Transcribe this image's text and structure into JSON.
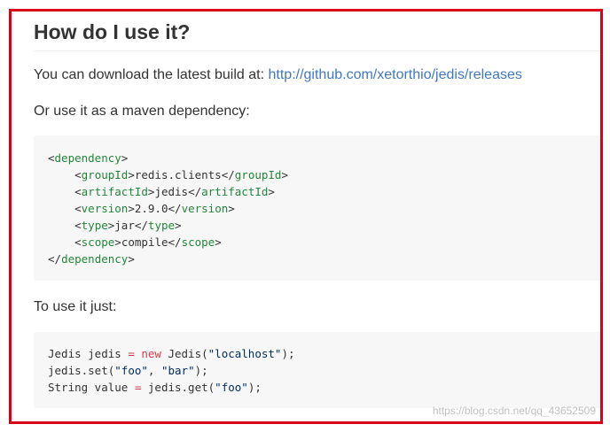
{
  "section": {
    "heading": "How do I use it?",
    "download_text": "You can download the latest build at: ",
    "download_link": "http://github.com/xetorthio/jedis/releases",
    "maven_text": "Or use it as a maven dependency:",
    "usage_text": "To use it just:"
  },
  "xml_code": {
    "dependency_tag": "dependency",
    "groupId_tag": "groupId",
    "groupId_value": "redis.clients",
    "artifactId_tag": "artifactId",
    "artifactId_value": "jedis",
    "version_tag": "version",
    "version_value": "2.9.0",
    "type_tag": "type",
    "type_value": "jar",
    "scope_tag": "scope",
    "scope_value": "compile"
  },
  "java_code": {
    "line1_a": "Jedis jedis ",
    "line1_op": "=",
    "line1_kw": "new",
    "line1_b": " Jedis(",
    "line1_str": "\"localhost\"",
    "line1_c": ");",
    "line2_a": "jedis.set(",
    "line2_str1": "\"foo\"",
    "line2_b": ", ",
    "line2_str2": "\"bar\"",
    "line2_c": ");",
    "line3_a": "String value ",
    "line3_op": "=",
    "line3_b": " jedis.get(",
    "line3_str": "\"foo\"",
    "line3_c": ");"
  },
  "watermark": "https://blog.csdn.net/qq_43652509",
  "colors": {
    "frame_border": "#d9001b",
    "link": "#4078c0",
    "xml_tag": "#22863a",
    "string": "#032f62",
    "keyword": "#d73a49",
    "code_bg": "#f7f7f7"
  }
}
